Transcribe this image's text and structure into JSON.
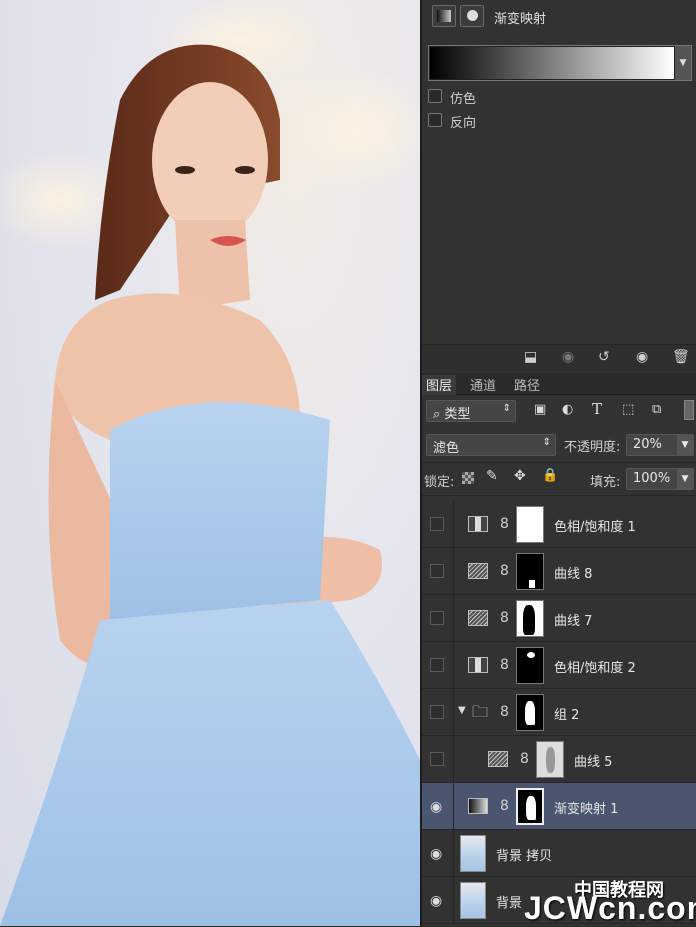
{
  "properties": {
    "title": "渐变映射",
    "dither_label": "仿色",
    "reverse_label": "反向"
  },
  "props_footer_icons": [
    "clip-to-layer-icon",
    "view-previous-icon",
    "reset-icon",
    "visibility-icon",
    "trash-icon"
  ],
  "tabs": [
    "图层",
    "通道",
    "路径"
  ],
  "filter": {
    "kind_label": "类型"
  },
  "blend": {
    "mode": "滤色",
    "opacity_label": "不透明度:",
    "opacity_value": "20%"
  },
  "lock": {
    "label": "锁定:",
    "fill_label": "填充:",
    "fill_value": "100%"
  },
  "layers": [
    {
      "name": "色相/饱和度 1",
      "type": "hue",
      "visible": false
    },
    {
      "name": "曲线 8",
      "type": "curves",
      "visible": false
    },
    {
      "name": "曲线 7",
      "type": "curves",
      "visible": false
    },
    {
      "name": "色相/饱和度 2",
      "type": "hue",
      "visible": false
    },
    {
      "name": "组 2",
      "type": "group",
      "visible": false
    },
    {
      "name": "曲线 5",
      "type": "curves",
      "visible": false
    },
    {
      "name": "渐变映射 1",
      "type": "gradient",
      "visible": true,
      "selected": true
    },
    {
      "name": "背景 拷贝",
      "type": "photo",
      "visible": true
    },
    {
      "name": "背景",
      "type": "photo",
      "visible": true
    }
  ],
  "watermark": {
    "line1": "中国教程网",
    "line2": "JCWcn.com"
  },
  "colors": {
    "panel_bg": "#323232",
    "selected_layer": "#4a5670",
    "dress": "#a9c8ea"
  }
}
